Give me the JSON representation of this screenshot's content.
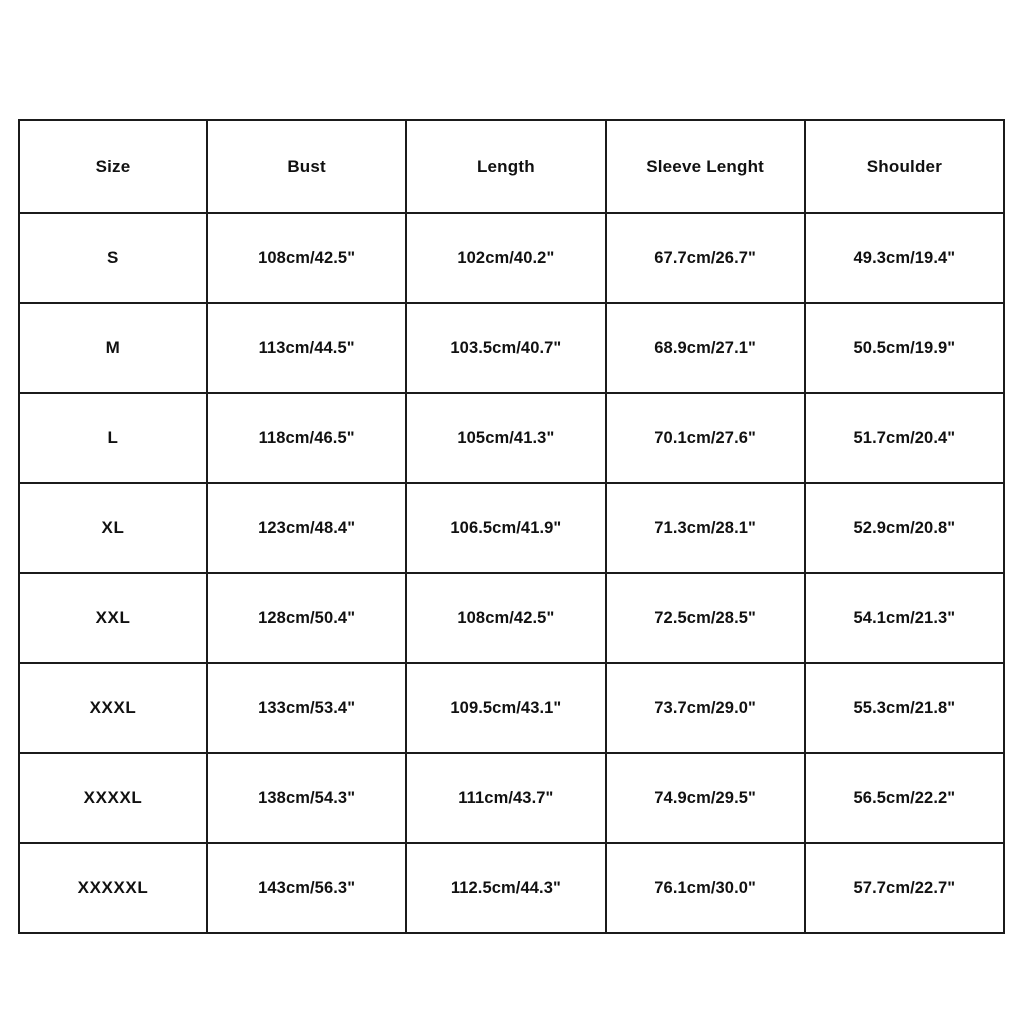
{
  "chart_data": {
    "type": "table",
    "title": "",
    "columns": [
      "Size",
      "Bust",
      "Length",
      "Sleeve Lenght",
      "Shoulder"
    ],
    "rows": [
      {
        "size": "S",
        "bust": "108cm/42.5\"",
        "length": "102cm/40.2\"",
        "sleeve_length": "67.7cm/26.7\"",
        "shoulder": "49.3cm/19.4\""
      },
      {
        "size": "M",
        "bust": "113cm/44.5\"",
        "length": "103.5cm/40.7\"",
        "sleeve_length": "68.9cm/27.1\"",
        "shoulder": "50.5cm/19.9\""
      },
      {
        "size": "L",
        "bust": "118cm/46.5\"",
        "length": "105cm/41.3\"",
        "sleeve_length": "70.1cm/27.6\"",
        "shoulder": "51.7cm/20.4\""
      },
      {
        "size": "XL",
        "bust": "123cm/48.4\"",
        "length": "106.5cm/41.9\"",
        "sleeve_length": "71.3cm/28.1\"",
        "shoulder": "52.9cm/20.8\""
      },
      {
        "size": "XXL",
        "bust": "128cm/50.4\"",
        "length": "108cm/42.5\"",
        "sleeve_length": "72.5cm/28.5\"",
        "shoulder": "54.1cm/21.3\""
      },
      {
        "size": "XXXL",
        "bust": "133cm/53.4\"",
        "length": "109.5cm/43.1\"",
        "sleeve_length": "73.7cm/29.0\"",
        "shoulder": "55.3cm/21.8\""
      },
      {
        "size": "XXXXL",
        "bust": "138cm/54.3\"",
        "length": "111cm/43.7\"",
        "sleeve_length": "74.9cm/29.5\"",
        "shoulder": "56.5cm/22.2\""
      },
      {
        "size": "XXXXXL",
        "bust": "143cm/56.3\"",
        "length": "112.5cm/44.3\"",
        "sleeve_length": "76.1cm/30.0\"",
        "shoulder": "57.7cm/22.7\""
      }
    ],
    "units": "cm/inch",
    "colors": {
      "background": "#ffffff",
      "text": "#111111",
      "border": "#1b1b1b"
    }
  },
  "table": {
    "headers": {
      "size": "Size",
      "bust": "Bust",
      "length": "Length",
      "sleeve_length": "Sleeve Lenght",
      "shoulder": "Shoulder"
    }
  }
}
